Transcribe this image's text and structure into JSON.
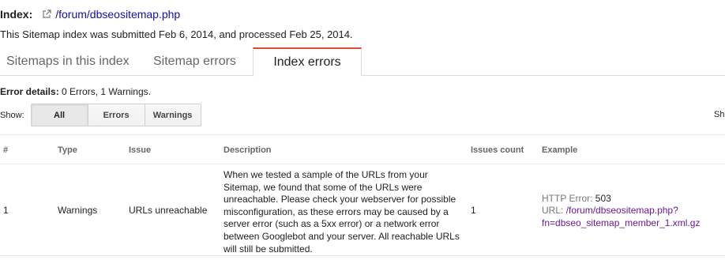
{
  "header": {
    "index_label": "Index:",
    "index_link": "/forum/dbseositemap.php",
    "submitted_text": "This Sitemap index was submitted Feb 6, 2014, and processed Feb 25, 2014."
  },
  "tabs": [
    {
      "label": "Sitemaps in this index"
    },
    {
      "label": "Sitemap errors"
    },
    {
      "label": "Index errors"
    }
  ],
  "error_details": {
    "label": "Error details:",
    "summary": "0 Errors, 1 Warnings."
  },
  "filter": {
    "show_label": "Show:",
    "options": [
      "All",
      "Errors",
      "Warnings"
    ],
    "selected": "All",
    "cut_text": "Sh"
  },
  "table": {
    "headers": [
      "#",
      "Type",
      "Issue",
      "Description",
      "Issues count",
      "Example"
    ],
    "rows": [
      {
        "num": "1",
        "type": "Warnings",
        "issue": "URLs unreachable",
        "description": "When we tested a sample of the URLs from your Sitemap, we found that some of the URLs were unreachable. Please check your webserver for possible misconfiguration, as these errors may be caused by a server error (such as a 5xx error) or a network error between Googlebot and your server. All reachable URLs will still be submitted.",
        "count": "1",
        "example_error_label": "HTTP Error:",
        "example_error_value": "503",
        "example_url_label": "URL:",
        "example_url": "/forum/dbseositemap.php?fn=dbseo_sitemap_member_1.xml.gz"
      }
    ]
  },
  "colors": {
    "link": "#1a0dab",
    "visited_link": "#6a1b9a",
    "active_tab_accent": "#dd4b39"
  }
}
